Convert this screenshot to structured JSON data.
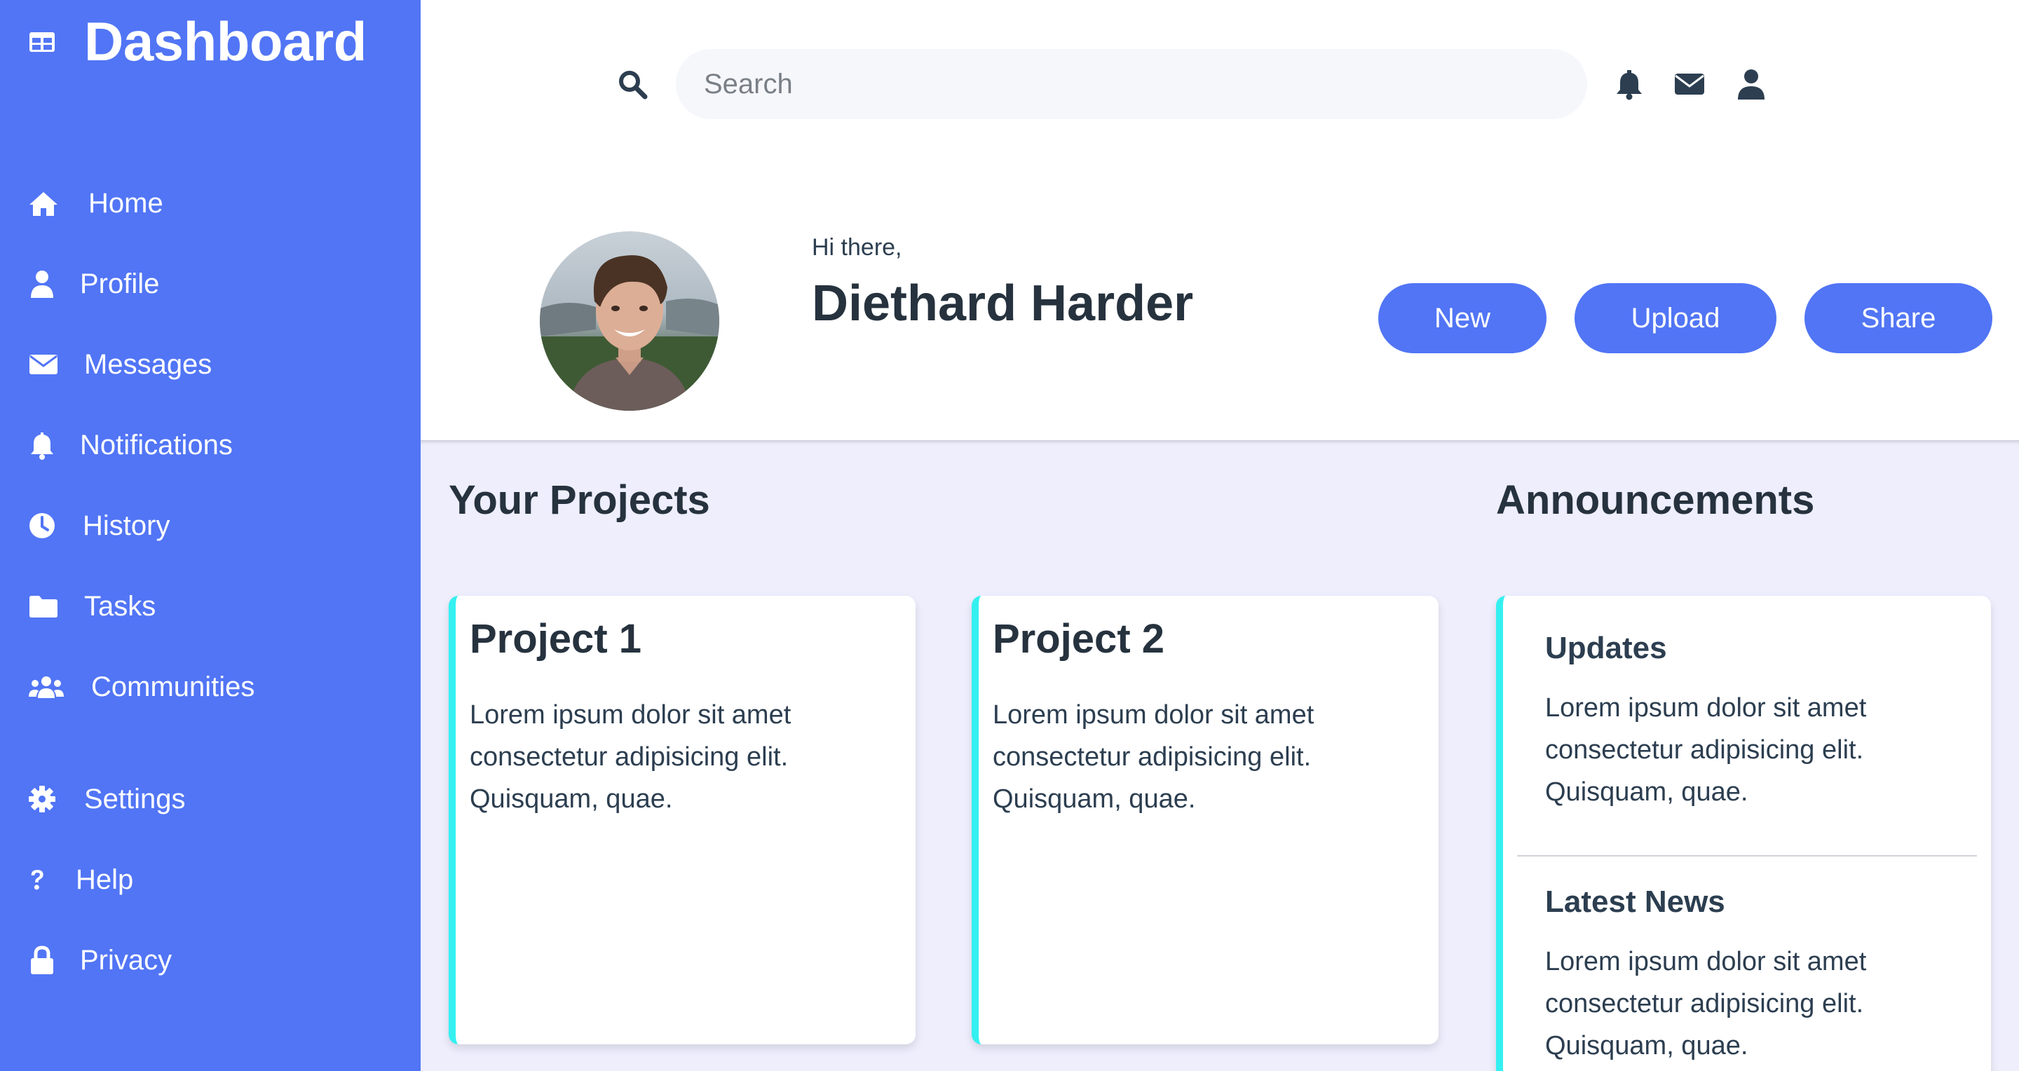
{
  "sidebar": {
    "brand": {
      "title": "Dashboard",
      "icon": "table-icon"
    },
    "items": [
      {
        "label": "Home",
        "icon": "home-icon"
      },
      {
        "label": "Profile",
        "icon": "user-icon"
      },
      {
        "label": "Messages",
        "icon": "envelope-icon"
      },
      {
        "label": "Notifications",
        "icon": "bell-icon"
      },
      {
        "label": "History",
        "icon": "clock-icon"
      },
      {
        "label": "Tasks",
        "icon": "folder-icon"
      },
      {
        "label": "Communities",
        "icon": "users-icon"
      },
      {
        "label": "Settings",
        "icon": "gear-icon"
      },
      {
        "label": "Help",
        "icon": "question-icon"
      },
      {
        "label": "Privacy",
        "icon": "lock-icon"
      }
    ]
  },
  "header": {
    "search": {
      "placeholder": "Search",
      "value": ""
    },
    "icons": [
      "bell-icon",
      "envelope-icon",
      "user-icon"
    ]
  },
  "profile": {
    "greeting": "Hi there,",
    "name": "Diethard Harder",
    "actions": {
      "new": "New",
      "upload": "Upload",
      "share": "Share"
    }
  },
  "projects": {
    "title": "Your Projects",
    "items": [
      {
        "title": "Project 1",
        "text": "Lorem ipsum dolor sit amet consectetur adipisicing elit. Quisquam, quae."
      },
      {
        "title": "Project 2",
        "text": "Lorem ipsum dolor sit amet consectetur adipisicing elit. Quisquam, quae."
      }
    ]
  },
  "announcements": {
    "title": "Announcements",
    "items": [
      {
        "title": "Updates",
        "text": "Lorem ipsum dolor sit amet consectetur adipisicing elit. Quisquam, quae."
      },
      {
        "title": "Latest News",
        "text": "Lorem ipsum dolor sit amet consectetur adipisicing elit. Quisquam, quae."
      }
    ]
  },
  "colors": {
    "sidebar": "#5175f5",
    "accent": "#5175f5",
    "card_border": "#35f0f0",
    "content_bg": "#eeeefd",
    "text": "#26323e"
  }
}
